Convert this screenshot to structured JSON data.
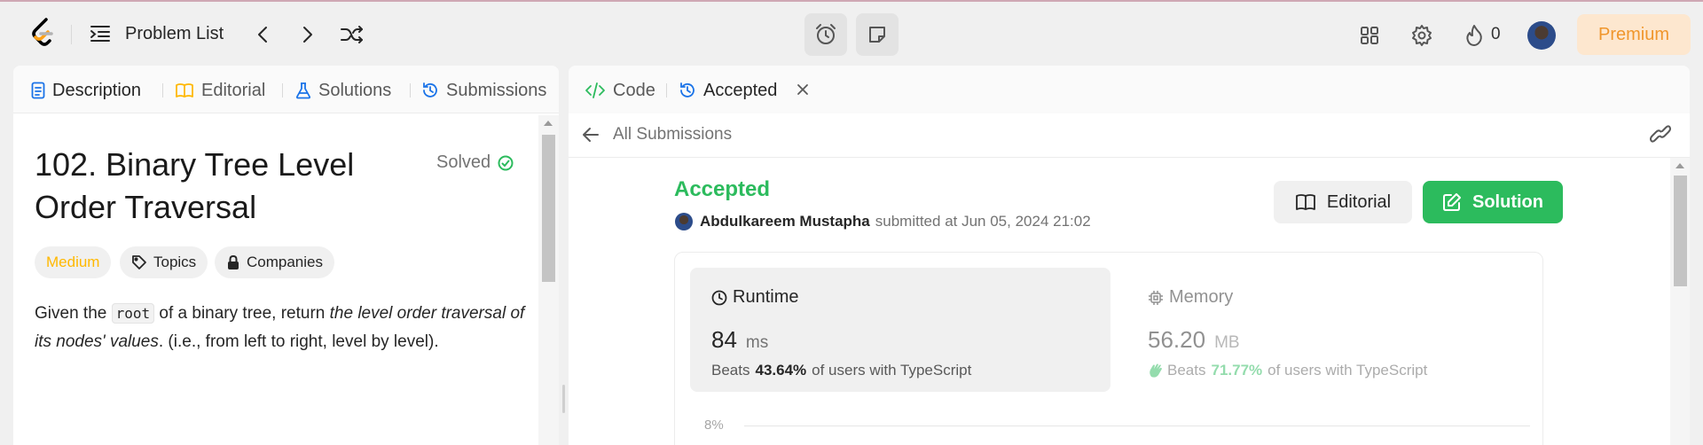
{
  "nav": {
    "problem_list": "Problem List",
    "streak_count": "0",
    "premium": "Premium"
  },
  "left_tabs": [
    {
      "label": "Description"
    },
    {
      "label": "Editorial"
    },
    {
      "label": "Solutions"
    },
    {
      "label": "Submissions"
    }
  ],
  "problem": {
    "title": "102. Binary Tree Level Order Traversal",
    "status": "Solved",
    "difficulty": "Medium",
    "topics": "Topics",
    "companies": "Companies",
    "desc_before": "Given the ",
    "desc_code": "root",
    "desc_middle": " of a binary tree, return ",
    "desc_italic": "the level order traversal of its nodes' values",
    "desc_after": ". (i.e., from left to right, level by level)."
  },
  "right_tabs": {
    "code": "Code",
    "accepted": "Accepted"
  },
  "subbar": {
    "all_submissions": "All Submissions"
  },
  "submission": {
    "status": "Accepted",
    "user": "Abdulkareem Mustapha",
    "submitted_at": "submitted at Jun 05, 2024 21:02",
    "editorial_btn": "Editorial",
    "solution_btn": "Solution"
  },
  "runtime": {
    "label": "Runtime",
    "value": "84",
    "unit": "ms",
    "beats_prefix": "Beats",
    "beats": "43.64%",
    "beats_suffix": "of users with TypeScript"
  },
  "memory": {
    "label": "Memory",
    "value": "56.20",
    "unit": "MB",
    "beats_prefix": "Beats",
    "beats": "71.77%",
    "beats_suffix": "of users with TypeScript"
  },
  "chart": {
    "y_tick": "8%"
  },
  "colors": {
    "accepted_green": "#2cbb5d",
    "medium_yellow": "#ffb800",
    "premium_orange": "#f0962c",
    "brand_orange": "#ffa116"
  }
}
